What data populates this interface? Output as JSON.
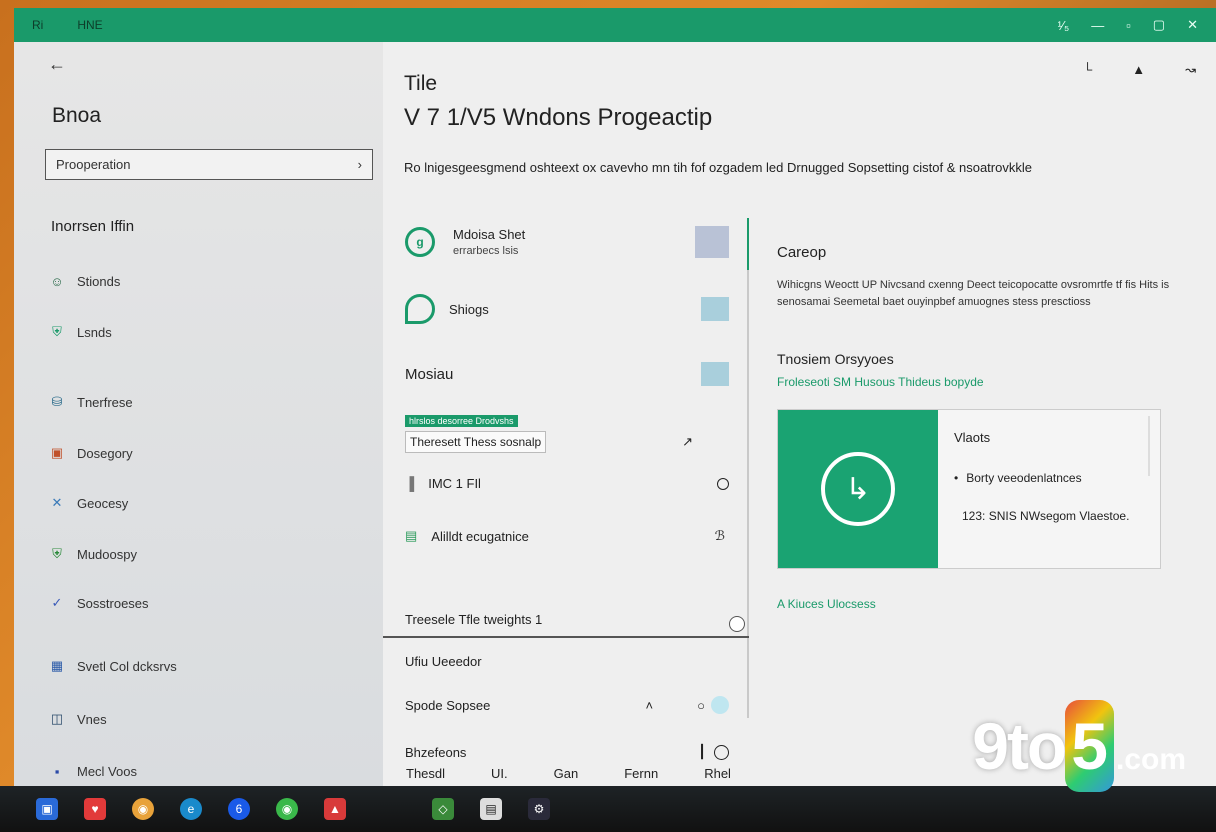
{
  "titlebar": {
    "left1": "Ri",
    "left2": "HNE",
    "ctrl_extra": "¹⁄₅"
  },
  "sidebar": {
    "title": "Bnoa",
    "search_placeholder": "Prooperation",
    "section": "Inorrsen Iffin",
    "items": [
      {
        "label": "Stionds",
        "icon": "person-icon"
      },
      {
        "label": "Lsnds",
        "icon": "shield-icon"
      },
      {
        "label": "Tnerfrese",
        "icon": "network-icon"
      },
      {
        "label": "Dosegory",
        "icon": "app-icon"
      },
      {
        "label": "Geocesy",
        "icon": "close-x-icon"
      },
      {
        "label": "Mudoospy",
        "icon": "shield-color-icon"
      },
      {
        "label": "Sosstroeses",
        "icon": "check-icon"
      },
      {
        "label": "Svetl Col dcksrvs",
        "icon": "grid-icon"
      },
      {
        "label": "Vnes",
        "icon": "window-icon"
      },
      {
        "label": "Mecl Voos",
        "icon": "square-icon"
      }
    ]
  },
  "main": {
    "tile": "Tile",
    "heading": "V 7 1/V5 Wndons Progeactip",
    "description": "Ro lnigesgeesgmend oshteext ox cavevho mn tih fof ozgadem led Drnugged Sopsetting cistof & nsoatrovkkle",
    "list": {
      "item1_title": "Mdoisa Shet",
      "item1_sub": "errarbecs lsis",
      "item2_title": "Shiogs",
      "item3_title": "Mosiau",
      "strip_text": "hlrslos desorree Drodvshs",
      "tooltip": "Theresett Thess sosnalp",
      "item4_title": "IMC 1 FIl",
      "item5_title": "Alilldt ecugatnice",
      "toggle_label": "Treesele Tfle tweights 1",
      "item6_title": "Ufiu Ueeedor",
      "item7_title": "Spode Sopsee",
      "item8_title": "Bhzefeons"
    },
    "footer_tabs": [
      "Thesdl",
      "UI.",
      "Gan",
      "Fernn",
      "Rhel"
    ],
    "right": {
      "h1": "Careop",
      "body": "Wihicgns Weoctt UP Nivcsand cxenng Deect teicopocatte ovsromrtfe tf fis Hits is senosamai Seemetal baet ouyinpbef amuognes stess presctioss",
      "h2": "Tnosiem Orsyyoes",
      "link": "Froleseoti SM Husous Thideus bopyde",
      "card_title": "Vlaots",
      "card_line1": "Borty veeodenlatnces",
      "card_line2": "123: SNIS NWsegom Vlaestoe.",
      "link2": "A Kiuces Ulocsess"
    }
  },
  "watermark": {
    "main": "9to",
    "five": "5",
    "com": ".com"
  }
}
